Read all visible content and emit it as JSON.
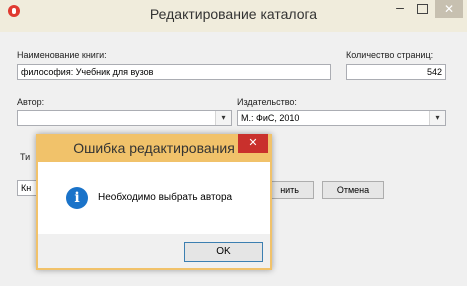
{
  "window": {
    "title": "Редактирование каталога",
    "minimize_glyph": "–",
    "close_glyph": "✕"
  },
  "form": {
    "book_name_label": "Наименование книги:",
    "book_name_value": "философия: Учебник для вузов",
    "pages_label": "Количество страниц:",
    "pages_value": "542",
    "author_label": "Автор:",
    "author_value": "",
    "publisher_label": "Издательство:",
    "publisher_value": "М.: ФиС, 2010",
    "type_label_partial": "Ти",
    "type_value_partial": "Кн",
    "save_button_partial": "нить",
    "cancel_button": "Отмена",
    "combo_arrow_glyph": "▾"
  },
  "dialog": {
    "title": "Ошибка редактирования",
    "message": "Необходимо выбрать автора",
    "ok_button": "OK",
    "close_glyph": "✕",
    "info_glyph": "i",
    "accent_color": "#f1c26a",
    "icon_color": "#1a73c9"
  }
}
